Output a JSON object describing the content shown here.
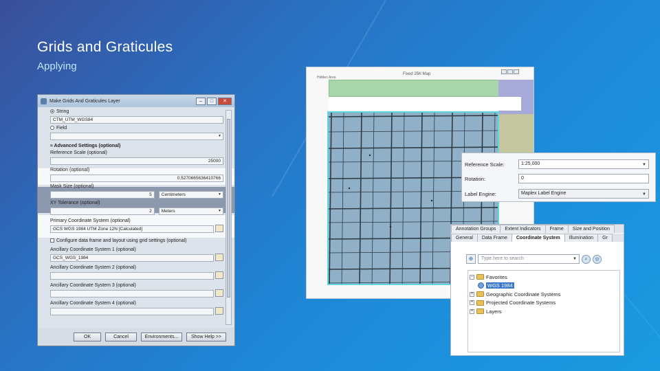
{
  "slide": {
    "title": "Grids and Graticules",
    "subtitle": "Applying"
  },
  "dialog": {
    "title": "Make Grids And Graticules Layer",
    "window_buttons": {
      "minimize": "–",
      "maximize": "□",
      "close": "✕"
    },
    "string_option": "String",
    "string_value": "CTM_UTM_WGS84",
    "field_option": "Field",
    "advanced_header": "Advanced Settings (optional)",
    "reference_scale_label": "Reference Scale (optional)",
    "reference_scale_value": "25000",
    "rotation_label": "Rotation (optional)",
    "rotation_value": "0.5270665636410766",
    "mask_size_label": "Mask Size (optional)",
    "mask_size_value": "5",
    "mask_size_unit": "Centimeters",
    "xy_tolerance_label": "XY Tolerance (optional)",
    "xy_tolerance_value": "2",
    "xy_tolerance_unit": "Meters",
    "primary_cs_label": "Primary Coordinate System (optional)",
    "primary_cs_value": "GCS WGS 1984 UTM Zone 12N [Calculated]",
    "configure_label": "Configure data frame and layout using grid settings (optional)",
    "ancillary": [
      {
        "label": "Ancillary Coordinate System 1 (optional)",
        "value": "GCS_WGS_1984"
      },
      {
        "label": "Ancillary Coordinate System 2 (optional)",
        "value": ""
      },
      {
        "label": "Ancillary Coordinate System 3 (optional)",
        "value": ""
      },
      {
        "label": "Ancillary Coordinate System 4 (optional)",
        "value": ""
      }
    ],
    "buttons": {
      "ok": "OK",
      "cancel": "Cancel",
      "environments": "Environments...",
      "show_help": "Show Help >>"
    }
  },
  "map_layout": {
    "title": "Fixed 25K Map",
    "corner_label": "Hidden Area"
  },
  "properties": {
    "reference_scale_label": "Reference Scale:",
    "reference_scale_value": "1:25,000",
    "rotation_label": "Rotation:",
    "rotation_value": "0",
    "label_engine_label": "Label Engine:",
    "label_engine_value": "Maplex Label Engine"
  },
  "coords_panel": {
    "tabs_row1": [
      "Annotation Groups",
      "Extent Indicators",
      "Frame",
      "Size and Position"
    ],
    "tabs_row2": [
      "General",
      "Data Frame",
      "Coordinate System",
      "Illumination",
      "Gr"
    ],
    "active_tab": "Coordinate System",
    "search_placeholder": "Type here to search",
    "tree": {
      "favorites": "Favorites",
      "wgs": "WGS 1984",
      "geographic": "Geographic Coordinate Systems",
      "projected": "Projected Coordinate Systems",
      "layers": "Layers"
    }
  },
  "colors": {
    "background_start": "#3a4f9a",
    "background_end": "#1a9be0",
    "grid_fill": "#8fb0c6",
    "grid_border": "#5fd5e0",
    "selection": "#3a78c9"
  }
}
